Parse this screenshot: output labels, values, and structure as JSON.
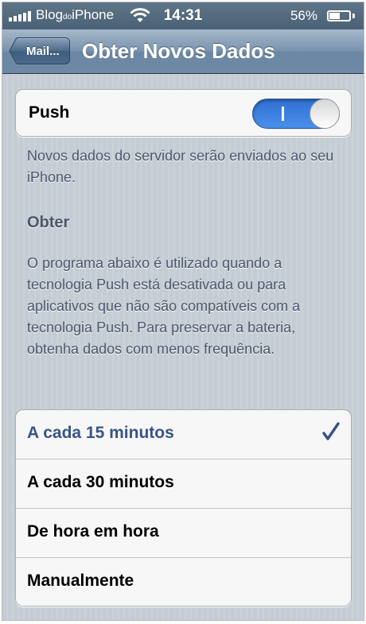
{
  "status_bar": {
    "carrier_main": "Blog",
    "carrier_small": "do",
    "carrier_end": "iPhone",
    "time": "14:31",
    "battery_percent": "56%",
    "battery_level": 0.56,
    "signal_icon": "signal-bars-icon",
    "wifi_icon": "wifi-icon"
  },
  "nav_bar": {
    "back_label": "Mail...",
    "title": "Obter Novos Dados"
  },
  "push": {
    "label": "Push",
    "enabled": true,
    "toggle_on_symbol": "I",
    "description": "Novos dados do servidor serão enviados ao seu iPhone."
  },
  "fetch": {
    "header": "Obter",
    "description": "O programa abaixo é utilizado quando a tecnologia Push está desativada ou para aplicativos que não são compatíveis com a tecnologia Push. Para preservar a bateria, obtenha dados com menos frequência."
  },
  "options": [
    {
      "label": "A cada 15 minutos",
      "selected": true
    },
    {
      "label": "A cada 30 minutos",
      "selected": false
    },
    {
      "label": "De hora em hora",
      "selected": false
    },
    {
      "label": "Manualmente",
      "selected": false
    }
  ],
  "colors": {
    "accent_blue": "#3b7fe0",
    "selected_text": "#385487",
    "footnote_text": "#4c566c"
  }
}
